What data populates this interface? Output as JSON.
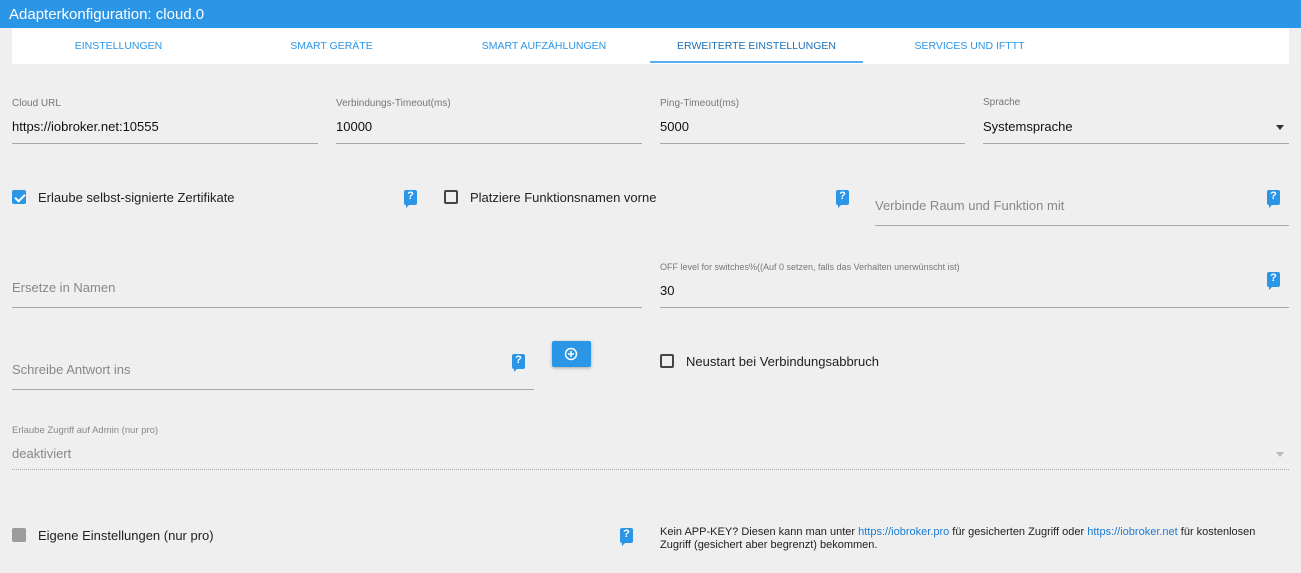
{
  "window": {
    "title": "Adapterkonfiguration: cloud.0"
  },
  "tabs": [
    {
      "label": "Einstellungen"
    },
    {
      "label": "Smart Geräte"
    },
    {
      "label": "Smart Aufzählungen"
    },
    {
      "label": "Erweiterte Einstellungen",
      "active": true
    },
    {
      "label": "Services und IFTTT"
    }
  ],
  "fields": {
    "cloud_url": {
      "label": "Cloud URL",
      "value": "https://iobroker.net:10555"
    },
    "connection_timeout": {
      "label": "Verbindungs-Timeout(ms)",
      "value": "10000"
    },
    "ping_timeout": {
      "label": "Ping-Timeout(ms)",
      "value": "5000"
    },
    "language": {
      "label": "Sprache",
      "value": "Systemsprache"
    },
    "room_function": {
      "placeholder": "Verbinde Raum und Funktion mit"
    },
    "replace_in_names": {
      "placeholder": "Ersetze in Namen"
    },
    "off_level": {
      "label": "OFF level for switches%((Auf 0 setzen, falls das Verhalten unerwünscht ist)",
      "value": "30"
    },
    "write_response": {
      "placeholder": "Schreibe Antwort ins"
    },
    "admin_access": {
      "label": "Erlaube Zugriff auf Admin (nur pro)",
      "value": "deaktiviert"
    }
  },
  "checkboxes": {
    "self_signed": {
      "label": "Erlaube selbst-signierte Zertifikate",
      "checked": true
    },
    "function_first": {
      "label": "Platziere Funktionsnamen vorne",
      "checked": false
    },
    "restart_on_disconnect": {
      "label": "Neustart bei Verbindungsabbruch",
      "checked": false
    },
    "own_settings": {
      "label": "Eigene Einstellungen (nur pro)",
      "checked": false,
      "disabled": true
    }
  },
  "help_glyph": "?",
  "info": {
    "text1": "Kein APP-KEY? Diesen kann man unter ",
    "link1": "https://iobroker.pro",
    "text2": " für gesicherten Zugriff oder ",
    "link2": "https://iobroker.net",
    "text3": " für kostenlosen Zugriff (gesichert aber begrenzt) bekommen."
  },
  "colors": {
    "accent": "#2b95e6",
    "background": "#efefef"
  }
}
